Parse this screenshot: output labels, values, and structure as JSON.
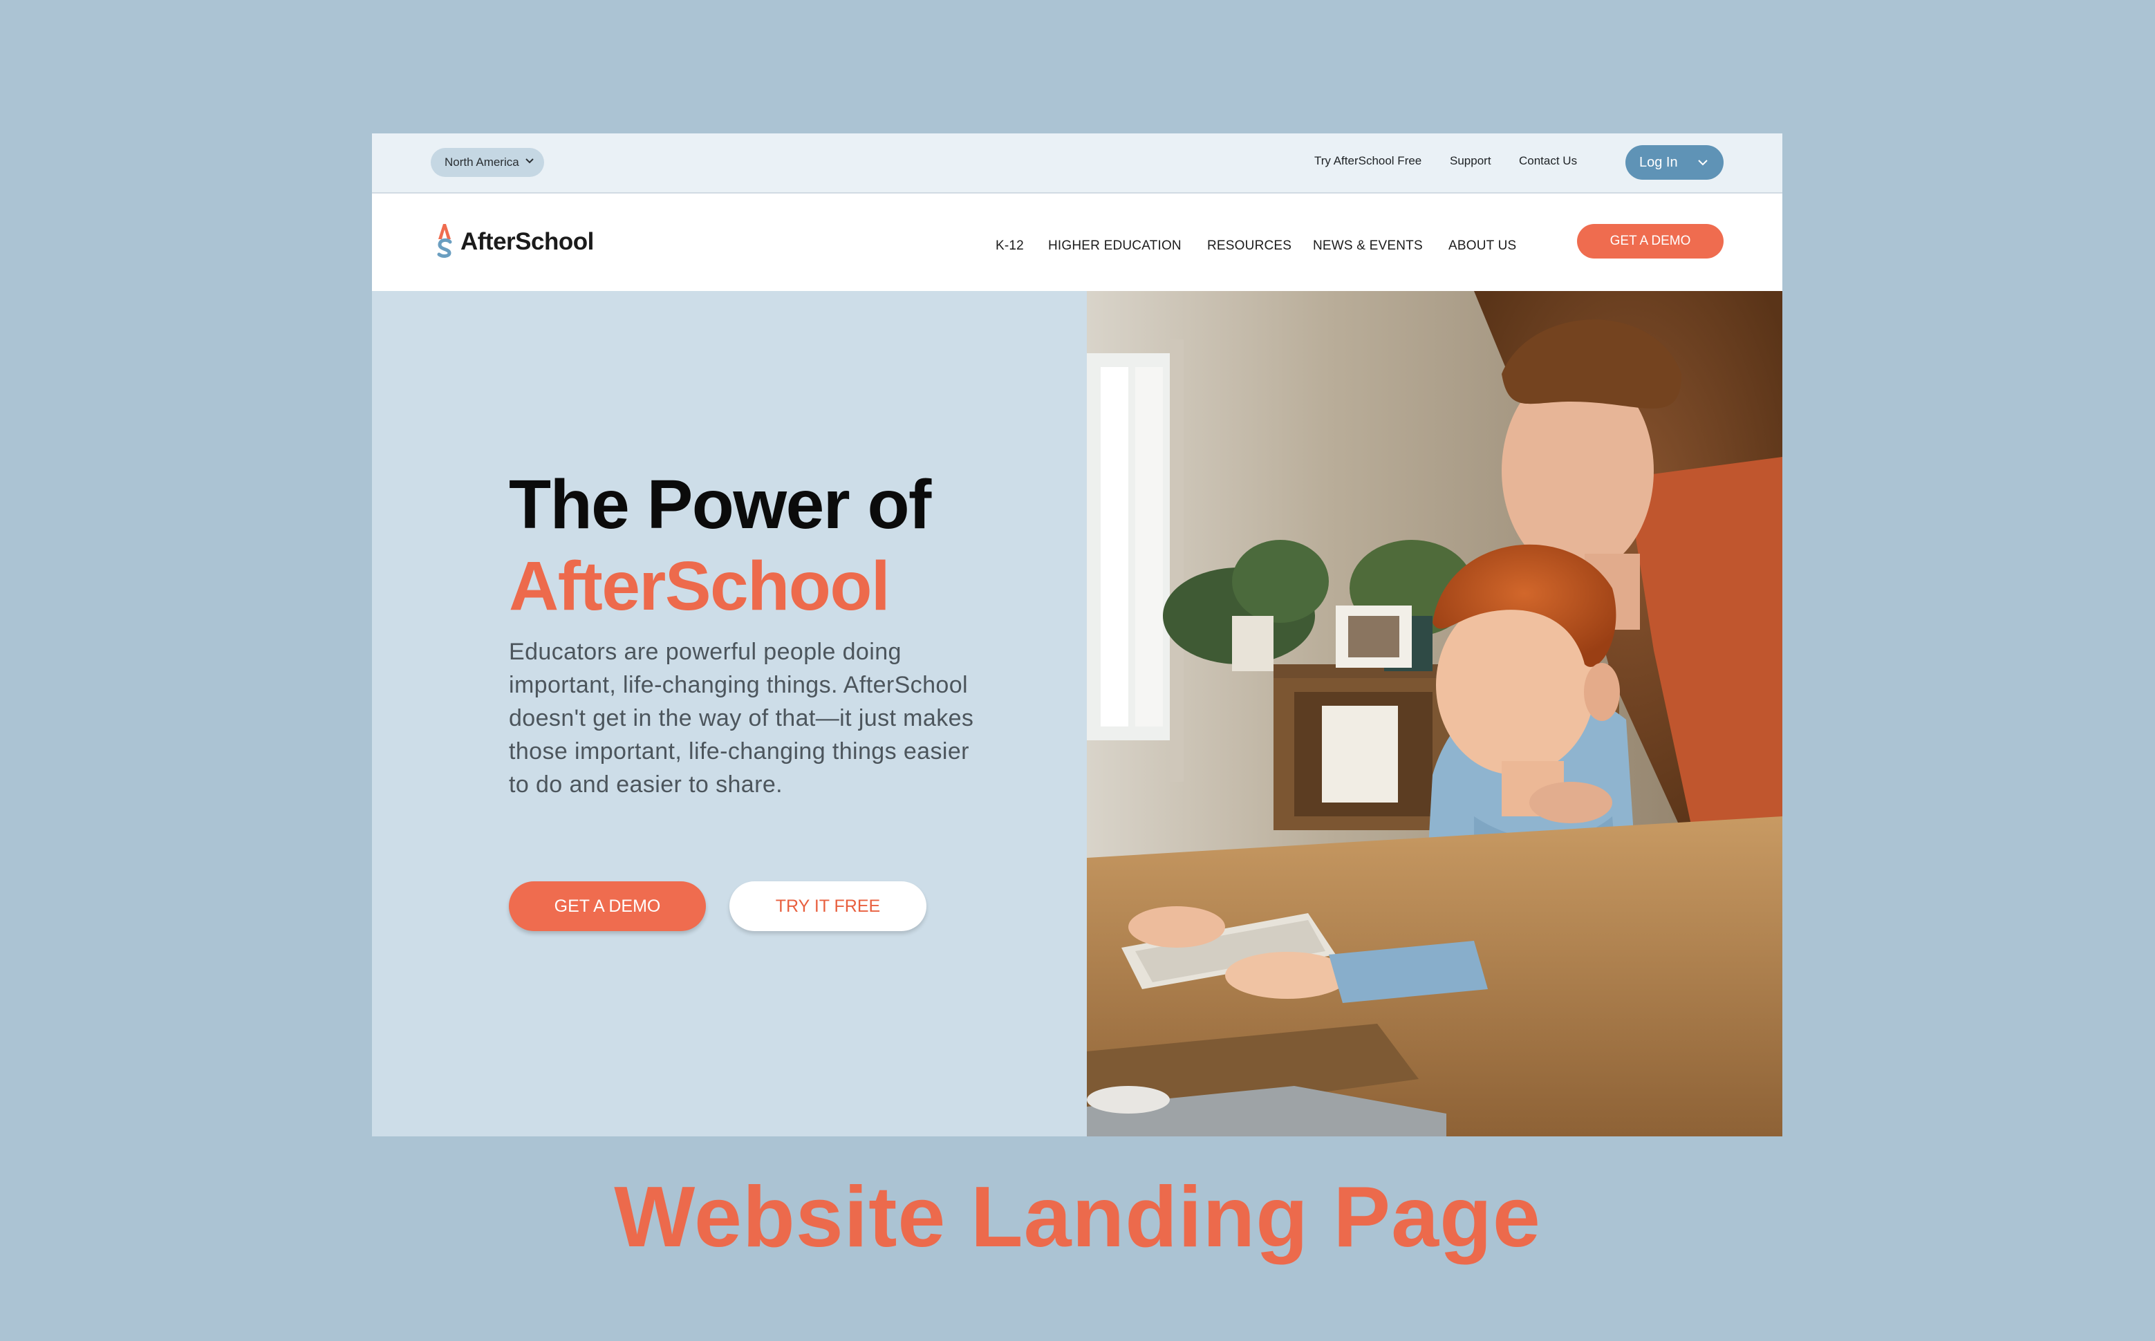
{
  "colors": {
    "page_background": "#abc3d3",
    "accent": "#ef6c4f",
    "hero_panel": "#cddde8",
    "login_button": "#5f93b6"
  },
  "utility_bar": {
    "region": "North America",
    "links": [
      "Try AfterSchool Free",
      "Support",
      "Contact Us"
    ],
    "login_label": "Log In"
  },
  "nav": {
    "logo_text": "AfterSchool",
    "items": [
      "K-12",
      "HIGHER EDUCATION",
      "RESOURCES",
      "NEWS & EVENTS",
      "ABOUT US"
    ],
    "cta_label": "GET A DEMO"
  },
  "hero": {
    "title_line1": "The Power of",
    "title_line2": "AfterSchool",
    "body": "Educators are powerful people doing important, life-changing things. AfterSchool doesn't get in the way of that—it just makes those important, life-changing things easier to do and easier to share.",
    "primary_button": "GET A DEMO",
    "secondary_button": "TRY IT FREE"
  },
  "caption": "Website Landing Page"
}
